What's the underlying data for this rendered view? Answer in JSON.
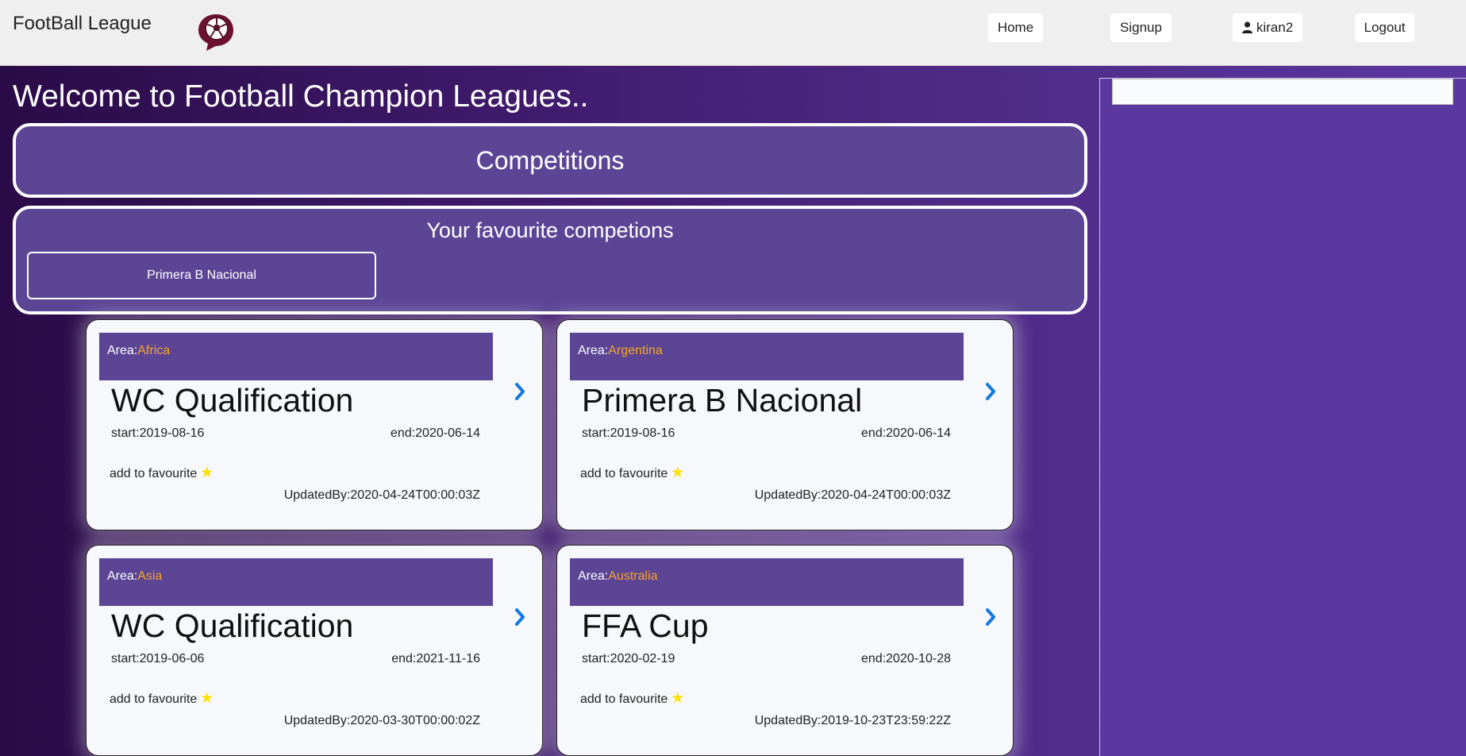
{
  "navbar": {
    "brand": "FootBall League",
    "home": "Home",
    "signup": "Signup",
    "user": "kiran2",
    "logout": "Logout"
  },
  "welcome": "Welcome to Football Champion Leagues..",
  "competitions_title": "Competitions",
  "favourites": {
    "title": "Your favourite competions",
    "items": [
      "Primera B Nacional"
    ]
  },
  "cards": [
    {
      "area_label": "Area:",
      "area": "Africa",
      "name": "WC Qualification",
      "start": "start:2019-08-16",
      "end": "end:2020-06-14",
      "fav": "add to favourite",
      "updated": "UpdatedBy:2020-04-24T00:00:03Z"
    },
    {
      "area_label": "Area:",
      "area": "Argentina",
      "name": "Primera B Nacional",
      "start": "start:2019-08-16",
      "end": "end:2020-06-14",
      "fav": "add to favourite",
      "updated": "UpdatedBy:2020-04-24T00:00:03Z"
    },
    {
      "area_label": "Area:",
      "area": "Asia",
      "name": "WC Qualification",
      "start": "start:2019-06-06",
      "end": "end:2021-11-16",
      "fav": "add to favourite",
      "updated": "UpdatedBy:2020-03-30T00:00:02Z"
    },
    {
      "area_label": "Area:",
      "area": "Australia",
      "name": "FFA Cup",
      "start": "start:2020-02-19",
      "end": "end:2020-10-28",
      "fav": "add to favourite",
      "updated": "UpdatedBy:2019-10-23T23:59:22Z"
    }
  ],
  "icons": {
    "logo": "football-chat-logo",
    "user": "user-icon",
    "star": "star-icon",
    "next": "chevron-right-icon"
  },
  "colors": {
    "accent": "#5d4596",
    "area_text": "#f5a623",
    "star": "#ffe100",
    "arrow": "#1479e0"
  }
}
